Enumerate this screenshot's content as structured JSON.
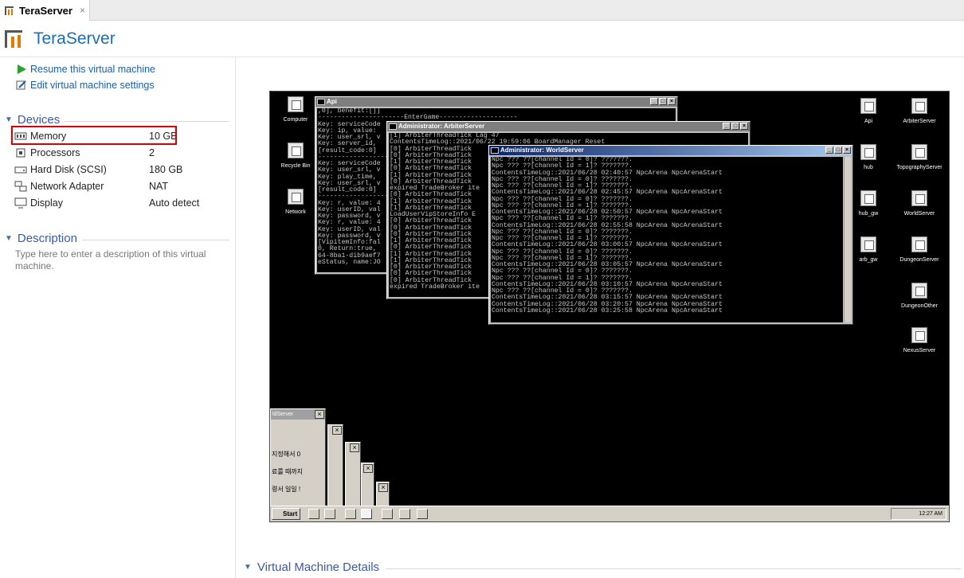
{
  "tab": {
    "label": "TeraServer",
    "close_glyph": "×"
  },
  "header": {
    "title": "TeraServer",
    "accent": "#1c6db3"
  },
  "actions": {
    "resume_label": "Resume this virtual machine",
    "edit_label": "Edit virtual machine settings"
  },
  "devices": {
    "title": "Devices",
    "items": [
      {
        "name": "Memory",
        "value": "10 GB",
        "icon": "memory-icon"
      },
      {
        "name": "Processors",
        "value": "2",
        "icon": "processor-icon"
      },
      {
        "name": "Hard Disk (SCSI)",
        "value": "180 GB",
        "icon": "hard-disk-icon"
      },
      {
        "name": "Network Adapter",
        "value": "NAT",
        "icon": "network-adapter-icon"
      },
      {
        "name": "Display",
        "value": "Auto detect",
        "icon": "display-icon"
      }
    ],
    "highlight_color": "#d60000"
  },
  "description": {
    "title": "Description",
    "placeholder": "Type here to enter a description of this virtual machine."
  },
  "details": {
    "title": "Virtual Machine Details"
  },
  "guest": {
    "left_icons": [
      "Computer",
      "Recycle Bin",
      "Network"
    ],
    "right_icons_col1": [
      "Api",
      "hub",
      "hub_gw",
      "arb_gw"
    ],
    "right_icons_col2": [
      "ArbiterServer",
      "TopographyServer",
      "WorldServer",
      "DungeonServer",
      "DungeonOther",
      "NexusServer"
    ],
    "api_window": {
      "title": "Api",
      "lines": [
        ",0], benefit:[]]",
        "----------------------EnterGame--------------------",
        "Key: serviceCode",
        "Key: ip, value:",
        "Key: user_srl, v",
        "Key: server_id,",
        "[result_code:0]",
        "------------------",
        "Key: serviceCode",
        "Key: user_srl, v",
        "Key: play_time,",
        "Key: user_srl, v",
        "[result_code:0]",
        "------------------",
        "",
        "Key: r, value: 4",
        "Key: userID, val",
        "Key: password, v",
        "",
        "Key: r, value: 4",
        "Key: userID, val",
        "Key: password, v",
        "[VipitemInfo:fal",
        "0, Return:true,",
        "64-8ba1-dib9aef7",
        "eStatus, name:JO"
      ]
    },
    "arbiter_window": {
      "title": "Administrator: ArbiterServer",
      "lines": [
        "[1] ArbiterThreadTick Lag 47",
        "ContentsTimeLog::2021/06/22 19:59:06 BoardManager Reset",
        "[0] ArbiterThreadTick",
        "[0] ArbiterThreadTick",
        "[1] ArbiterThreadTick",
        "[0] ArbiterThreadTick",
        "[1] ArbiterThreadTick",
        "[0] ArbiterThreadTick",
        "expired TradeBroker ite",
        "[0] ArbiterThreadTick",
        "[1] ArbiterThreadTick",
        "[1] ArbiterThreadTick",
        "LoadUserVipStoreInfo E",
        "[0] ArbiterThreadTick",
        "[0] ArbiterThreadTick",
        "[0] ArbiterThreadTick",
        "[1] ArbiterThreadTick",
        "[0] ArbiterThreadTick",
        "[1] ArbiterThreadTick",
        "[1] ArbiterThreadTick",
        "[0] ArbiterThreadTick",
        "[0] ArbiterThreadTick",
        "[0] ArbiterThreadTick",
        "expired TradeBroker ite"
      ]
    },
    "world_window": {
      "title": "Administrator: WorldServer",
      "lines": [
        "Npc ??? ??[channel Id = 0]? ???????.",
        "Npc ??? ??[channel Id = 1]? ???????.",
        "ContentsTimeLog::2021/06/28 02:40:57 NpcArena NpcArenaStart",
        "Npc ??? ??[channel Id = 0]? ???????.",
        "Npc ??? ??[channel Id = 1]? ???????.",
        "ContentsTimeLog::2021/06/28 02:45:57 NpcArena NpcArenaStart",
        "Npc ??? ??[channel Id = 0]? ???????.",
        "Npc ??? ??[channel Id = 1]? ???????.",
        "ContentsTimeLog::2021/06/28 02:50:57 NpcArena NpcArenaStart",
        "Npc ??? ??[channel Id = 1]? ???????.",
        "ContentsTimeLog::2021/06/28 02:55:58 NpcArena NpcArenaStart",
        "Npc ??? ??[channel Id = 0]? ???????.",
        "Npc ??? ??[channel Id = 1]? ???????.",
        "ContentsTimeLog::2021/06/28 03:00:57 NpcArena NpcArenaStart",
        "Npc ??? ??[channel Id = 0]? ???????.",
        "Npc ??? ??[channel Id = 1]? ???????.",
        "ContentsTimeLog::2021/06/28 03:05:57 NpcArena NpcArenaStart",
        "Npc ??? ??[channel Id = 0]? ???????.",
        "Npc ??? ??[channel Id = 1]? ???????.",
        "ContentsTimeLog::2021/06/28 03:10:57 NpcArena NpcArenaStart",
        "Npc ??? ??[channel Id = 0]? ???????.",
        "ContentsTimeLog::2021/06/28 03:15:57 NpcArena NpcArenaStart",
        "ContentsTimeLog::2021/06/28 03:20:57 NpcArena NpcArenaStart",
        "ContentsTimeLog::2021/06/28 03:25:58 NpcArena NpcArenaStart"
      ]
    },
    "stacked_title": "ldServer",
    "stacked_texts": [
      "지정해서 0",
      "료를 때까지",
      "령서 일일 !"
    ],
    "start_label": "Start",
    "clock": "12:27 AM"
  }
}
